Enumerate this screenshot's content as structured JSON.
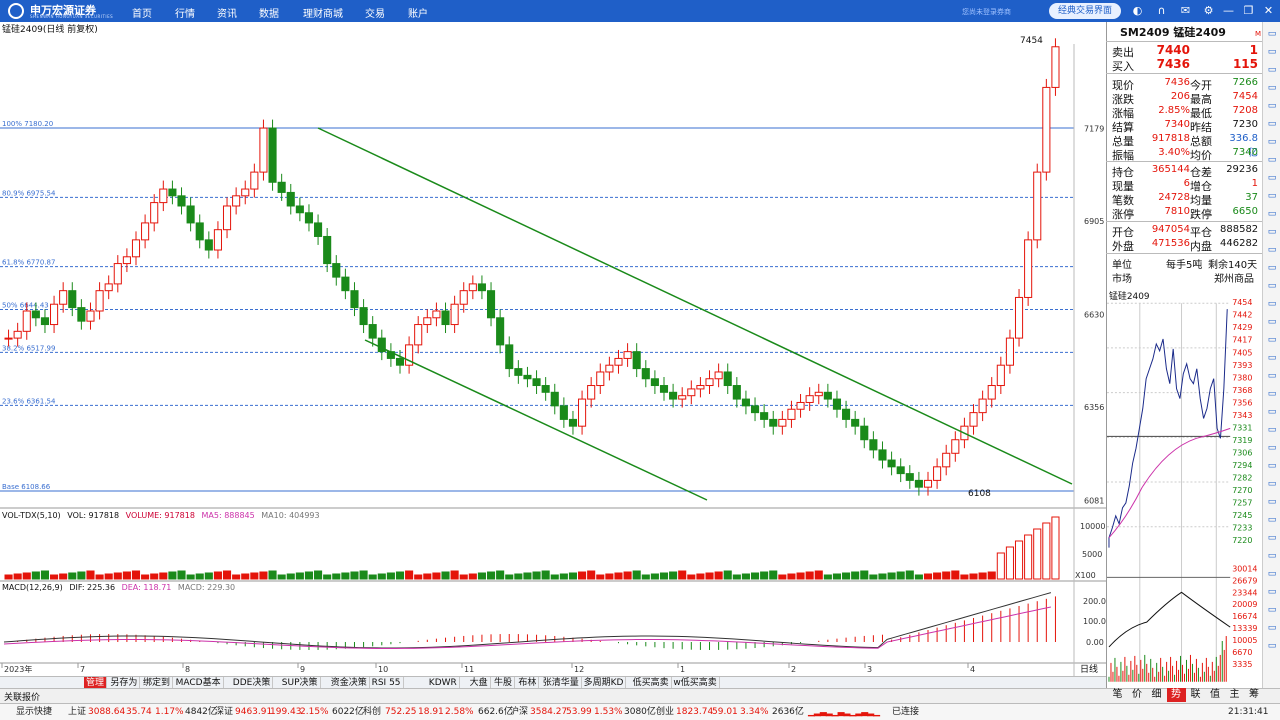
{
  "app": {
    "logo_text": "申万宏源证券",
    "logo_sub": "SHENWAN HONGYUAN SECURITIES",
    "nav": [
      "首页",
      "行情",
      "资讯",
      "数据",
      "理财商城",
      "交易",
      "账户"
    ],
    "login_hint": "您尚未登录券商",
    "classic_label": "经典交易界面",
    "colors": {
      "brand": "#1f5fc8",
      "up": "#e4140a",
      "down": "#1a8a1a"
    },
    "top_icons": [
      "display-icon",
      "headset-icon",
      "mail-icon",
      "gear-icon",
      "minimize-icon",
      "restore-icon",
      "close-icon"
    ]
  },
  "chart_title": "锰硅2409(日线 前复权)",
  "fib": [
    {
      "label": "100% 7180.20",
      "price": 7180.2
    },
    {
      "label": "80.9% 6975.54",
      "price": 6975.54
    },
    {
      "label": "61.8% 6770.87",
      "price": 6770.87
    },
    {
      "label": "50% 6644.43",
      "price": 6644.43
    },
    {
      "label": "38.2% 6517.99",
      "price": 6517.99
    },
    {
      "label": "23.6% 6361.54",
      "price": 6361.54
    },
    {
      "label": "Base 6108.66",
      "price": 6108.66
    }
  ],
  "price_axis": [
    "7179",
    "6905",
    "6630",
    "6356",
    "6081"
  ],
  "annotations": {
    "high": "7454",
    "low": "6108"
  },
  "volume": {
    "label_name": "VOL-TDX(5,10)",
    "label_vol": "VOL: 917818",
    "label_volume": "VOLUME: 917818",
    "label_ma5": "MA5: 888845",
    "label_ma10": "MA10: 404993",
    "axis": [
      "10000",
      "5000"
    ],
    "unit": "X100"
  },
  "macd": {
    "label_name": "MACD(12,26,9)",
    "label_dif": "DIF: 225.36",
    "label_dea": "DEA: 118.71",
    "label_macd": "MACD: 229.30",
    "axis": [
      "200.0",
      "100.0",
      "0.00"
    ]
  },
  "time_axis": [
    "2023年",
    "7",
    "8",
    "9",
    "10",
    "11",
    "12",
    "1",
    "2",
    "3",
    "4"
  ],
  "period_label": "日线",
  "chart_data": {
    "type": "candlestick",
    "title": "锰硅2409(日线 前复权)",
    "ylim": [
      6081,
      7454
    ],
    "high": 7454,
    "low": 6108,
    "series": [
      {
        "name": "VOLUME",
        "values": [
          917818
        ]
      },
      {
        "name": "MA5",
        "values": [
          888845
        ]
      },
      {
        "name": "MA10",
        "values": [
          404993
        ]
      },
      {
        "name": "DIF",
        "values": [
          225.36
        ]
      },
      {
        "name": "DEA",
        "values": [
          118.71
        ]
      },
      {
        "name": "MACD",
        "values": [
          229.3
        ]
      }
    ]
  },
  "quote": {
    "code_name": "SM2409 锰硅2409",
    "sell_label": "卖出",
    "sell_price": "7440",
    "sell_vol": "1",
    "buy_label": "买入",
    "buy_price": "7436",
    "buy_vol": "115",
    "rows": [
      [
        "现价",
        "7436",
        "今开",
        "7266"
      ],
      [
        "涨跌",
        "206",
        "最高",
        "7454"
      ],
      [
        "涨幅",
        "2.85%",
        "最低",
        "7208"
      ],
      [
        "结算",
        "7340",
        "昨结",
        "7230"
      ],
      [
        "总量",
        "917818",
        "总额",
        "336.8亿"
      ],
      [
        "振幅",
        "3.40%",
        "均价",
        "7340"
      ]
    ],
    "rows2": [
      [
        "持仓",
        "365144",
        "仓差",
        "29236"
      ],
      [
        "现量",
        "6",
        "增仓",
        "1"
      ],
      [
        "笔数",
        "24728",
        "均量",
        "37"
      ],
      [
        "涨停",
        "7810",
        "跌停",
        "6650"
      ]
    ],
    "rows3": [
      [
        "开仓",
        "947054",
        "平仓",
        "888582"
      ],
      [
        "外盘",
        "471536",
        "内盘",
        "446282"
      ]
    ],
    "unit_label": "单位",
    "unit_value": "每手5吨",
    "remain_value": "剩余140天",
    "market_label": "市场",
    "market_value": "郑州商品"
  },
  "mini": {
    "title": "锰硅2409",
    "axis": [
      "7454",
      "7442",
      "7429",
      "7417",
      "7405",
      "7393",
      "7380",
      "7368",
      "7356",
      "7343",
      "7331",
      "7319",
      "7306",
      "7294",
      "7282",
      "7270",
      "7257",
      "7245",
      "7233",
      "7220"
    ],
    "vol_axis": [
      "30014",
      "26679",
      "23344",
      "20009",
      "16674",
      "13339",
      "10005",
      "6670",
      "3335"
    ]
  },
  "tabs": [
    "管理",
    "另存为",
    "绑定到",
    "MACD基本",
    "DDE决策",
    "SUP决策",
    "资金决策",
    "RSI 55",
    "KDWR",
    "大盘",
    "牛股",
    "布林",
    "张清华量",
    "多周期KD",
    "低买高卖",
    "w低买高卖"
  ],
  "mini_tabs": [
    "笔",
    "价",
    "细",
    "势",
    "联",
    "值",
    "主",
    "筹"
  ],
  "left_tab": "关联报价",
  "status": {
    "quick": "显示快捷",
    "sh_name": "上证",
    "sh_val": "3088.64",
    "sh_chg": "35.74",
    "sh_pct": "1.17%",
    "sh_amt": "4842亿",
    "sz_name": "深证",
    "sz_val": "9463.91",
    "sz_chg": "199.43",
    "sz_pct": "2.15%",
    "sz_amt": "6022亿",
    "kc_name": "科创",
    "kc_val": "752.25",
    "kc_chg": "18.91",
    "kc_pct": "2.58%",
    "kc_amt": "662.6亿",
    "hs_name": "沪深",
    "hs_val": "3584.27",
    "hs_chg": "53.99",
    "hs_pct": "1.53%",
    "hs_amt": "3080亿",
    "cy_name": "创业",
    "cy_val": "1823.74",
    "cy_chg": "59.01",
    "cy_pct": "3.34%",
    "cy_amt": "2636亿",
    "conn": "已连接",
    "time": "21:31:41"
  }
}
